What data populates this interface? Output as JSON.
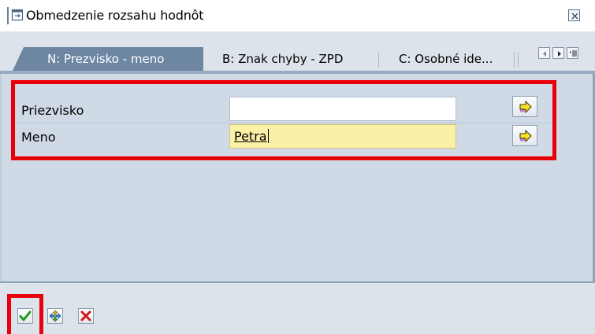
{
  "window": {
    "title": "Obmedzenie rozsahu hodnôt",
    "title_icon": "dialog-window-icon",
    "close_icon": "close-icon"
  },
  "tabs": [
    {
      "label": "N: Prezvisko - meno",
      "active": true
    },
    {
      "label": "B: Znak chyby - ZPD",
      "active": false
    },
    {
      "label": "C: Osobné ide...",
      "active": false
    }
  ],
  "tab_nav": {
    "prev_icon": "triangle-left-icon",
    "next_icon": "triangle-right-icon",
    "list_icon": "tab-list-icon"
  },
  "form": {
    "fields": [
      {
        "label": "Priezvisko",
        "value": ""
      },
      {
        "label": "Meno",
        "value": "Petra"
      }
    ],
    "arrow_icon": "yellow-arrow-right-icon"
  },
  "toolbar": {
    "buttons": [
      {
        "name": "confirm",
        "icon": "green-checkmark-icon"
      },
      {
        "name": "multiple-selection",
        "icon": "multi-select-arrows-icon"
      },
      {
        "name": "cancel",
        "icon": "red-x-icon"
      }
    ]
  },
  "colors": {
    "active_tab": "#6d86a2",
    "content_bg": "#d0dae6",
    "highlight_red": "#e8000b",
    "filled_input": "#fcf0a7"
  }
}
